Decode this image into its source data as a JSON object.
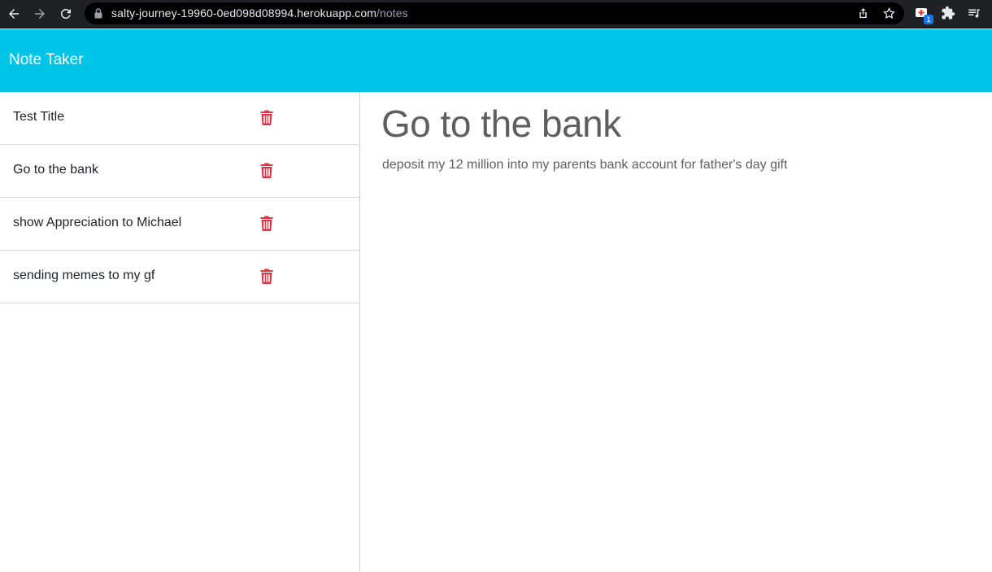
{
  "browser": {
    "url_host": "salty-journey-19960-0ed098d08994.herokuapp.com",
    "url_path": "/notes",
    "extension_badge": "1",
    "icons": [
      "back-arrow-icon",
      "forward-arrow-icon",
      "reload-icon",
      "lock-icon",
      "share-icon",
      "star-icon",
      "extension-icon",
      "puzzle-icon",
      "reading-list-icon"
    ]
  },
  "header": {
    "title": "Note Taker",
    "background_color": "#00c5e8"
  },
  "notes": [
    {
      "title": "Test Title"
    },
    {
      "title": "Go to the bank"
    },
    {
      "title": "show Appreciation to Michael"
    },
    {
      "title": "sending memes to my gf"
    }
  ],
  "active_note": {
    "title": "Go to the bank",
    "text": "deposit my 12 million into my parents bank account for father's day gift"
  },
  "colors": {
    "delete_icon": "#dc3545",
    "note_text": "#5f5f5f"
  }
}
